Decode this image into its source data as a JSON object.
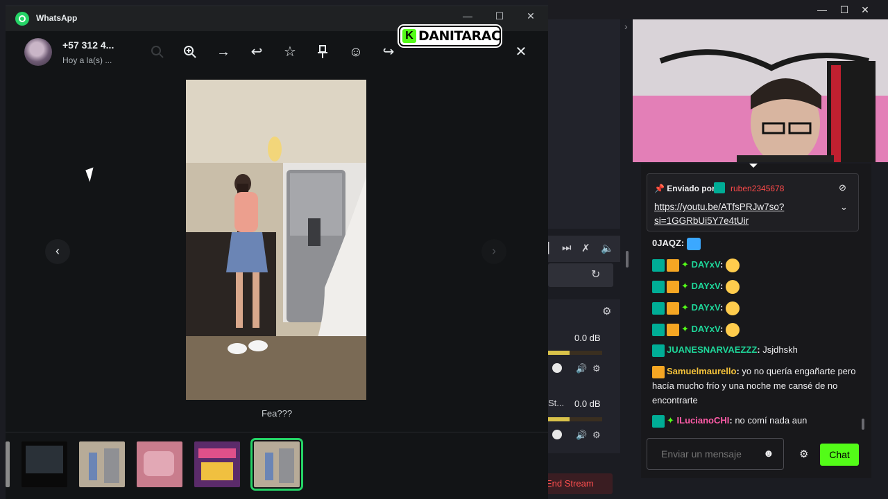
{
  "whatsapp": {
    "title": "WhatsApp",
    "contact_name": "+57 312 4...",
    "contact_time": "Hoy a la(s) ...",
    "caption": "Fea???",
    "icons": [
      "search-icon",
      "zoom-in-icon",
      "arrow-right-icon",
      "reply-icon",
      "star-icon",
      "pin-icon",
      "emoji-icon",
      "forward-icon",
      "close-icon"
    ]
  },
  "overlay": {
    "kick_letter": "K",
    "streamer_name": "DANITARAC"
  },
  "obs": {
    "db_1": "0.0 dB",
    "db_2": "0.0 dB",
    "scene_partial": "St...",
    "end_stream": "End Stream"
  },
  "chat": {
    "pinned_label": "Enviado por",
    "pinned_user": "ruben2345678",
    "pinned_link": "https://youtu.be/ATfsPRJw7so?si=1GGRbUi5Y7e4tUir",
    "messages": [
      {
        "user": "0JAQZ",
        "text": "",
        "color": "#efeff1"
      },
      {
        "user": "DAYxV",
        "text": "",
        "color": "#1ed79a"
      },
      {
        "user": "DAYxV",
        "text": "",
        "color": "#1ed79a"
      },
      {
        "user": "DAYxV",
        "text": "",
        "color": "#1ed79a"
      },
      {
        "user": "DAYxV",
        "text": "",
        "color": "#1ed79a"
      },
      {
        "user": "JUANESNARVAEZZZ",
        "text": "Jsjdhskh",
        "color": "#1ed79a"
      },
      {
        "user": "Samuelmaurello",
        "text": "yo no quería engañarte pero hacía mucho frío y una noche me cansé de no encontrarte",
        "color": "#f5c33b"
      },
      {
        "user": "ILucianoCHI",
        "text": "no comí nada aun",
        "color": "#ff5ca8"
      }
    ],
    "input_placeholder": "Enviar un mensaje",
    "send_label": "Chat"
  }
}
